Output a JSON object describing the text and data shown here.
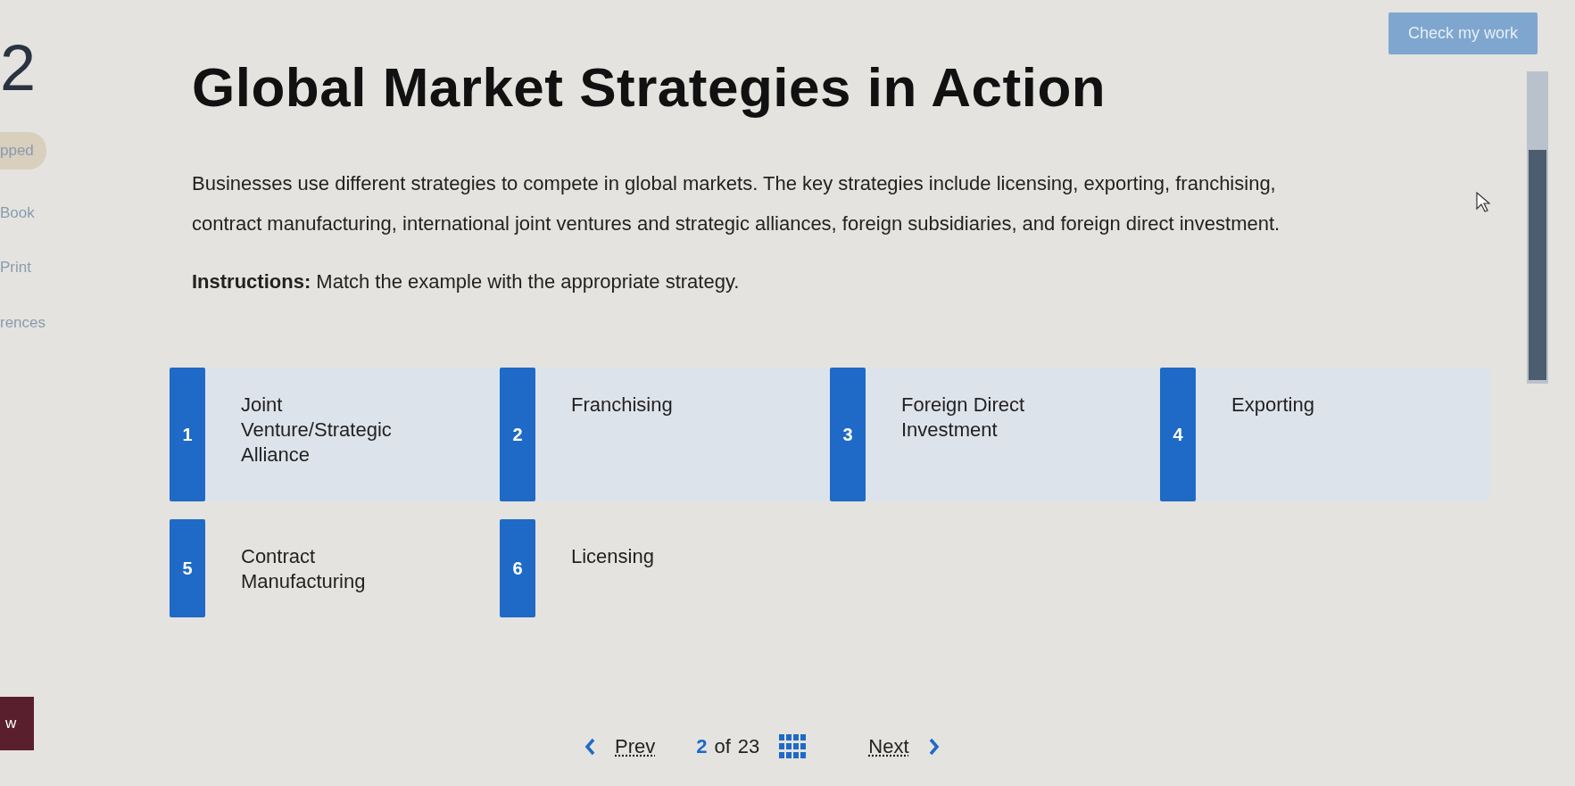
{
  "sidebar": {
    "chapter_number": "2",
    "items": [
      {
        "label": "pped",
        "kind": "pill"
      },
      {
        "label": "Book",
        "kind": "link"
      },
      {
        "label": "Print",
        "kind": "link"
      },
      {
        "label": "rences",
        "kind": "link"
      }
    ],
    "bottom_button": "w"
  },
  "header": {
    "button": "Check my work",
    "title": "Global Market Strategies in Action"
  },
  "intro": "Businesses use different strategies to compete in global markets. The key strategies include licensing, exporting, franchising, contract manufacturing, international joint ventures and strategic alliances, foreign subsidiaries, and foreign direct investment.",
  "instructions": "**Instructions:** Match the example with the appropriate strategy.",
  "strategies": [
    {
      "number": "1",
      "label": "Joint Venture/Strategic Alliance"
    },
    {
      "number": "2",
      "label": "Franchising"
    },
    {
      "number": "3",
      "label": "Foreign Direct Investment"
    },
    {
      "number": "4",
      "label": "Exporting"
    },
    {
      "number": "5",
      "label": "Contract Manufacturing"
    },
    {
      "number": "6",
      "label": "Licensing"
    }
  ],
  "pager": {
    "prev": "Prev",
    "current": "2",
    "of": "of",
    "total": "23",
    "next": "Next"
  }
}
